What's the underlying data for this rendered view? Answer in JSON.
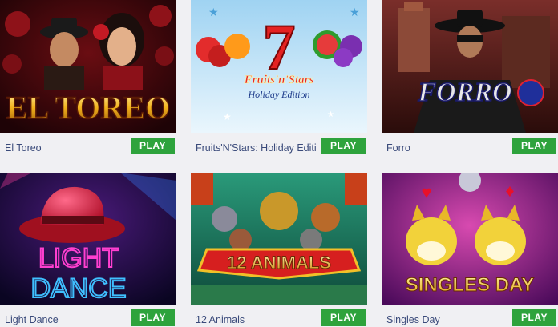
{
  "colors": {
    "play_button": "#2ea33c",
    "title_text": "#3a4a7a",
    "page_bg": "#f0f0f3"
  },
  "games": [
    {
      "title": "El Toreo",
      "play_label": "PLAY",
      "logo": "EL TOREO",
      "icon": "el-toreo-thumbnail"
    },
    {
      "title": "Fruits'N'Stars: Holiday Edition",
      "play_label": "PLAY",
      "logo_main": "Fruits'n'Stars",
      "logo_sub": "Holiday Edition",
      "logo_number": "7",
      "icon": "fruits-n-stars-thumbnail"
    },
    {
      "title": "Forro",
      "play_label": "PLAY",
      "logo": "FORRO",
      "icon": "forro-thumbnail"
    },
    {
      "title": "Light Dance",
      "play_label": "PLAY",
      "logo_line1": "LIGHT",
      "logo_line2": "DANCE",
      "icon": "light-dance-thumbnail"
    },
    {
      "title": "12 Animals",
      "play_label": "PLAY",
      "logo": "12 ANIMALS",
      "icon": "12-animals-thumbnail"
    },
    {
      "title": "Singles Day",
      "play_label": "PLAY",
      "logo": "SINGLES DAY",
      "icon": "singles-day-thumbnail"
    }
  ]
}
